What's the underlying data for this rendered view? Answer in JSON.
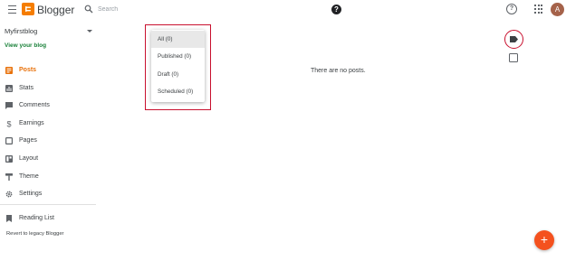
{
  "header": {
    "brand": "Blogger",
    "search_placeholder": "Search",
    "help_glyph": "?",
    "help_outline_glyph": "?",
    "avatar_initial": "A",
    "icons": [
      "menu-icon",
      "blogger-logo-icon",
      "search-icon",
      "help-icon",
      "help-outline-icon",
      "apps-icon"
    ]
  },
  "sidebar": {
    "blog_name": "Myfirstblog",
    "view_blog": "View your blog",
    "items": [
      {
        "label": "Posts",
        "icon": "posts-icon",
        "active": true
      },
      {
        "label": "Stats",
        "icon": "stats-icon",
        "active": false
      },
      {
        "label": "Comments",
        "icon": "comments-icon",
        "active": false
      },
      {
        "label": "Earnings",
        "icon": "dollar-icon",
        "active": false
      },
      {
        "label": "Pages",
        "icon": "pages-icon",
        "active": false
      },
      {
        "label": "Layout",
        "icon": "layout-icon",
        "active": false
      },
      {
        "label": "Theme",
        "icon": "paint-roller-icon",
        "active": false
      },
      {
        "label": "Settings",
        "icon": "gear-icon",
        "active": false
      }
    ],
    "reading_list": "Reading List",
    "legacy": "Revert to legacy Blogger"
  },
  "main": {
    "empty_message": "There are no posts.",
    "filter_options": [
      {
        "label": "All (0)",
        "selected": true
      },
      {
        "label": "Published (0)",
        "selected": false
      },
      {
        "label": "Draft (0)",
        "selected": false
      },
      {
        "label": "Scheduled (0)",
        "selected": false
      }
    ],
    "fab_glyph": "+"
  },
  "colors": {
    "accent": "#e8710a",
    "highlight_border": "#c8102e",
    "fab": "#f4511e",
    "link": "#188038"
  }
}
